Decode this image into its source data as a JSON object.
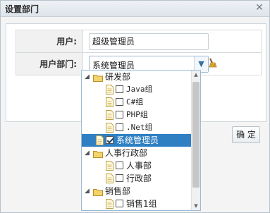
{
  "dialog": {
    "title": "设置部门"
  },
  "form": {
    "username_label": "用户:",
    "username_value": "超级管理员",
    "dept_label": "用户部门:",
    "dept_value": "系统管理员"
  },
  "buttons": {
    "ok_label": "确 定"
  },
  "tree": [
    {
      "label": "研发部",
      "kind": "folder",
      "level": 0
    },
    {
      "label": "Java组",
      "kind": "file",
      "level": 1,
      "checked": false,
      "mono": true
    },
    {
      "label": "C#组",
      "kind": "file",
      "level": 1,
      "checked": false,
      "mono": true
    },
    {
      "label": "PHP组",
      "kind": "file",
      "level": 1,
      "checked": false,
      "mono": true
    },
    {
      "label": ".Net组",
      "kind": "file",
      "level": 1,
      "checked": false,
      "mono": true
    },
    {
      "label": "系统管理员",
      "kind": "file",
      "level": 0,
      "checked": true,
      "selected": true
    },
    {
      "label": "人事行政部",
      "kind": "folder",
      "level": 0
    },
    {
      "label": "人事部",
      "kind": "file",
      "level": 1,
      "checked": false
    },
    {
      "label": "行政部",
      "kind": "file",
      "level": 1,
      "checked": false
    },
    {
      "label": "销售部",
      "kind": "folder",
      "level": 0
    },
    {
      "label": "销售1组",
      "kind": "file",
      "level": 1,
      "checked": false
    }
  ],
  "icons": {
    "close": "close-icon",
    "dropdown": "chevron-down-icon",
    "clear": "broom-icon",
    "folder": "folder-icon",
    "file": "file-icon"
  },
  "colors": {
    "selected_bg": "#2f7fc3",
    "accent": "#3a6f9e"
  }
}
